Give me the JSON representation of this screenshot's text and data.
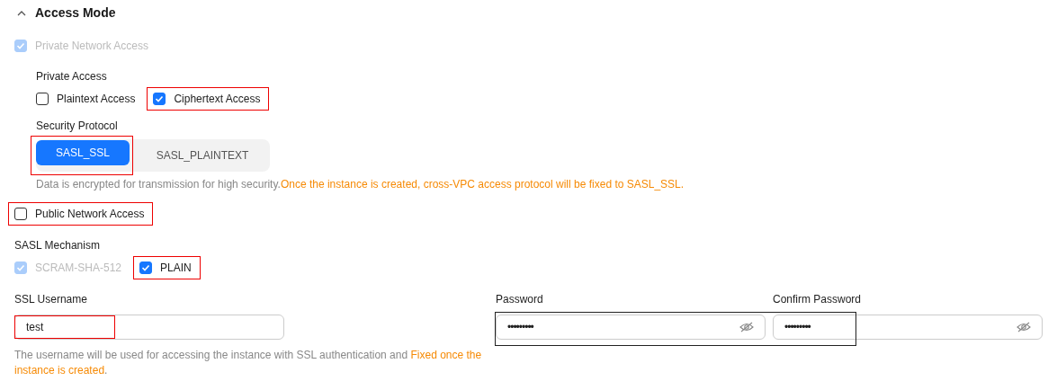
{
  "section": {
    "title": "Access Mode",
    "expanded": true
  },
  "private_network": {
    "label": "Private Network Access",
    "checked": true,
    "disabled": true
  },
  "private_access": {
    "label": "Private Access",
    "options": [
      {
        "label": "Plaintext Access",
        "checked": false,
        "disabled": false,
        "highlighted": false
      },
      {
        "label": "Ciphertext Access",
        "checked": true,
        "disabled": false,
        "highlighted": true
      }
    ]
  },
  "security_protocol": {
    "label": "Security Protocol",
    "options": [
      {
        "label": "SASL_SSL",
        "selected": true,
        "highlighted": true
      },
      {
        "label": "SASL_PLAINTEXT",
        "selected": false,
        "highlighted": false
      }
    ],
    "note": "Data is encrypted for transmission for high security.",
    "warning": "Once the instance is created, cross-VPC access protocol will be fixed to SASL_SSL."
  },
  "public_network": {
    "label": "Public Network Access",
    "checked": false,
    "disabled": false,
    "highlighted": true
  },
  "sasl_mechanism": {
    "label": "SASL Mechanism",
    "options": [
      {
        "label": "SCRAM-SHA-512",
        "checked": true,
        "disabled": true,
        "highlighted": false
      },
      {
        "label": "PLAIN",
        "checked": true,
        "disabled": false,
        "highlighted": true
      }
    ]
  },
  "ssl_username": {
    "label": "SSL Username",
    "value": "test",
    "highlighted": true,
    "hint": "The username will be used for accessing the instance with SSL authentication and ",
    "hint_warning": "Fixed once the instance is created",
    "hint_end": "."
  },
  "password": {
    "label": "Password",
    "value": "•••••••••"
  },
  "confirm_password": {
    "label": "Confirm Password",
    "value": "•••••••••"
  },
  "passwords_highlighted": true
}
